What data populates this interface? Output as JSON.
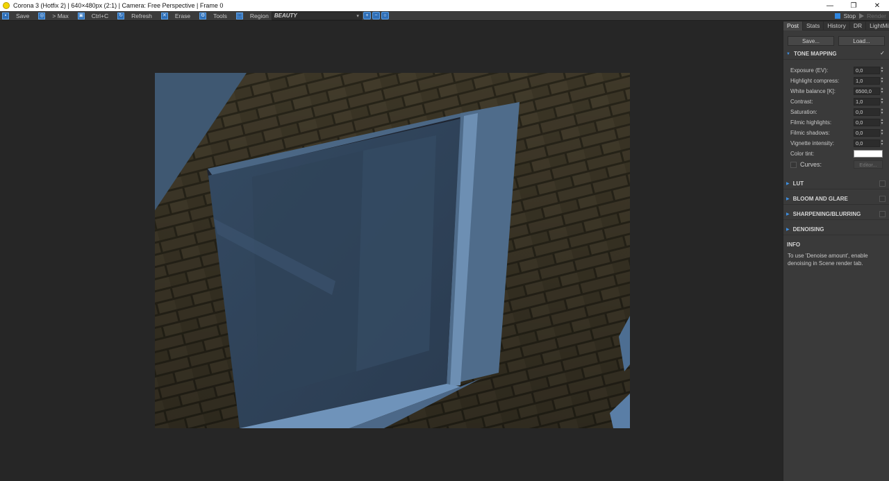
{
  "window": {
    "title": "Corona 3 (Hotfix 2) | 640×480px (2:1) | Camera: Free Perspective | Frame 0",
    "controls": [
      "—",
      "❐",
      "✕"
    ]
  },
  "toolbar": {
    "save": "Save",
    "max": "> Max",
    "copy": "Ctrl+C",
    "refresh": "Refresh",
    "erase": "Erase",
    "tools": "Tools",
    "region": "Region",
    "pass": "BEAUTY",
    "stop": "Stop",
    "render": "Render"
  },
  "panel": {
    "tabs": [
      "Post",
      "Stats",
      "History",
      "DR",
      "LightMix"
    ],
    "active_tab": "Post",
    "save_btn": "Save...",
    "load_btn": "Load...",
    "tone_mapping": {
      "title": "TONE MAPPING",
      "enabled": "✓",
      "params": [
        {
          "label": "Exposure (EV):",
          "value": "0,0"
        },
        {
          "label": "Highlight compress:",
          "value": "1,0"
        },
        {
          "label": "White balance [K]:",
          "value": "6500,0"
        },
        {
          "label": "Contrast:",
          "value": "1,0"
        },
        {
          "label": "Saturation:",
          "value": "0,0"
        },
        {
          "label": "Filmic highlights:",
          "value": "0,0"
        },
        {
          "label": "Filmic shadows:",
          "value": "0,0"
        },
        {
          "label": "Vignette intensity:",
          "value": "0,0"
        }
      ],
      "color_tint_label": "Color tint:",
      "color_tint": "#ffffff",
      "curves_label": "Curves:",
      "editor_btn": "Editor..."
    },
    "sections": {
      "lut": "LUT",
      "bloom": "BLOOM AND GLARE",
      "sharpen": "SHARPENING/BLURRING",
      "denoise": "DENOISING"
    },
    "info": {
      "title": "INFO",
      "text": "To use 'Denoise amount', enable denoising in Scene render tab."
    }
  },
  "colors": {
    "accent": "#2f86e0",
    "brick": "#3a3524",
    "glass": "#3a4f66"
  }
}
